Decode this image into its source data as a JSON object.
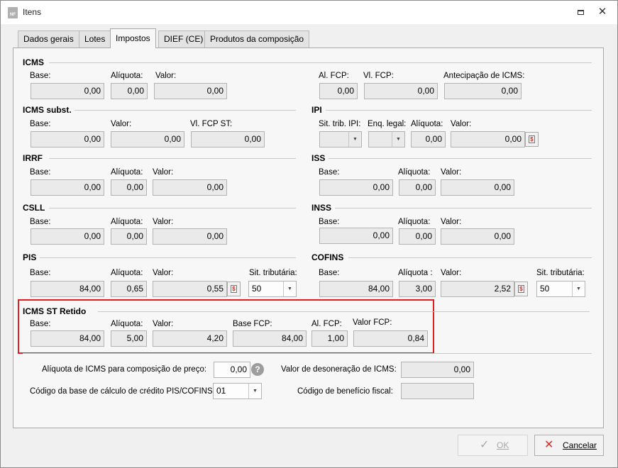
{
  "window": {
    "title": "Itens",
    "app_icon_text": "NF"
  },
  "tabs": [
    {
      "label": "Dados gerais"
    },
    {
      "label": "Lotes"
    },
    {
      "label": "Impostos"
    },
    {
      "label": "DIEF (CE)"
    },
    {
      "label": "Produtos da composição"
    }
  ],
  "icms": {
    "title": "ICMS",
    "base_label": "Base:",
    "base": "0,00",
    "aliquota_label": "Alíquota:",
    "aliquota": "0,00",
    "valor_label": "Valor:",
    "valor": "0,00",
    "al_fcp_label": "Al. FCP:",
    "al_fcp": "0,00",
    "vl_fcp_label": "Vl. FCP:",
    "vl_fcp": "0,00",
    "antecipacao_label": "Antecipação de ICMS:",
    "antecipacao": "0,00"
  },
  "icms_subst": {
    "title": "ICMS subst.",
    "base_label": "Base:",
    "base": "0,00",
    "valor_label": "Valor:",
    "valor": "0,00",
    "vl_fcp_st_label": "Vl. FCP ST:",
    "vl_fcp_st": "0,00"
  },
  "ipi": {
    "title": "IPI",
    "sit_trib_label": "Sit. trib. IPI:",
    "sit_trib": "",
    "enq_legal_label": "Enq. legal:",
    "enq_legal": "",
    "aliquota_label": "Alíquota:",
    "aliquota": "0,00",
    "valor_label": "Valor:",
    "valor": "0,00"
  },
  "irrf": {
    "title": "IRRF",
    "base_label": "Base:",
    "base": "0,00",
    "aliquota_label": "Alíquota:",
    "aliquota": "0,00",
    "valor_label": "Valor:",
    "valor": "0,00"
  },
  "iss": {
    "title": "ISS",
    "base_label": "Base:",
    "base": "0,00",
    "aliquota_label": "Alíquota:",
    "aliquota": "0,00",
    "valor_label": "Valor:",
    "valor": "0,00"
  },
  "csll": {
    "title": "CSLL",
    "base_label": "Base:",
    "base": "0,00",
    "aliquota_label": "Alíquota:",
    "aliquota": "0,00",
    "valor_label": "Valor:",
    "valor": "0,00"
  },
  "inss": {
    "title": "INSS",
    "base_label": "Base:",
    "base": "0,00",
    "aliquota_label": "Alíquota:",
    "aliquota": "0,00",
    "valor_label": "Valor:",
    "valor": "0,00"
  },
  "pis": {
    "title": "PIS",
    "base_label": "Base:",
    "base": "84,00",
    "aliquota_label": "Alíquota:",
    "aliquota": "0,65",
    "valor_label": "Valor:",
    "valor": "0,55",
    "sit_trib_label": "Sit. tributária:",
    "sit_trib": "50"
  },
  "cofins": {
    "title": "COFINS",
    "base_label": "Base:",
    "base": "84,00",
    "aliquota_label": "Alíquota :",
    "aliquota": "3,00",
    "valor_label": "Valor:",
    "valor": "2,52",
    "sit_trib_label": "Sit. tributária:",
    "sit_trib": "50"
  },
  "icms_st_retido": {
    "title": "ICMS ST Retido",
    "base_label": "Base:",
    "base": "84,00",
    "aliquota_label": "Alíquota:",
    "aliquota": "5,00",
    "valor_label": "Valor:",
    "valor": "4,20",
    "base_fcp_label": "Base FCP:",
    "base_fcp": "84,00",
    "al_fcp_label": "Al. FCP:",
    "al_fcp": "1,00",
    "valor_fcp_label": "Valor FCP:",
    "valor_fcp": "0,84"
  },
  "extras": {
    "aliq_composicao_label": "Alíquota de ICMS para composição de preço:",
    "aliq_composicao": "0,00",
    "cod_base_label": "Código da base de cálculo de crédito PIS/COFINS:",
    "cod_base": "01",
    "valor_desoneracao_label": "Valor de desoneração de ICMS:",
    "valor_desoneracao": "0,00",
    "cod_beneficio_label": "Código de benefício fiscal:",
    "cod_beneficio": ""
  },
  "buttons": {
    "ok": "OK",
    "cancel": "Cancelar"
  },
  "icons": {
    "app": "nf-app-icon",
    "restore": "restore-icon",
    "close": "close-icon",
    "calc": "calculator-icon",
    "help": "question-icon",
    "ok": "check-icon",
    "cancel": "x-icon",
    "dropdown": "chevron-down-icon"
  },
  "colors": {
    "highlight_box": "#e02020",
    "cancel_icon": "#d0312d",
    "field_bg": "#eaeaea"
  }
}
